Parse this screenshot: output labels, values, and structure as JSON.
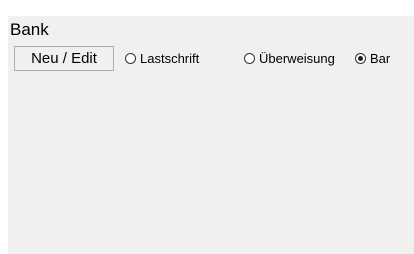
{
  "group": {
    "title": "Bank"
  },
  "edit_button": {
    "label": "Neu / Edit"
  },
  "payment_options": [
    {
      "label": "Lastschrift",
      "checked": false
    },
    {
      "label": "Überweisung",
      "checked": false
    },
    {
      "label": "Bar",
      "checked": true
    }
  ]
}
